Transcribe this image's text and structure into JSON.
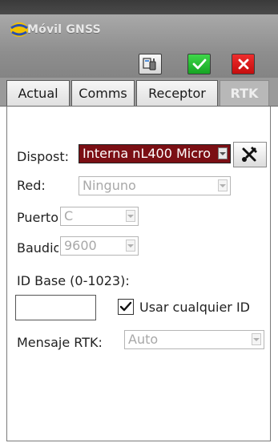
{
  "window": {
    "title": "Móvil GNSS",
    "buttons": {
      "settings_icon": "settings-icon",
      "ok_icon": "checkmark-icon",
      "cancel_icon": "close-icon"
    }
  },
  "tabs": [
    {
      "label": "Actual"
    },
    {
      "label": "Comms"
    },
    {
      "label": "Receptor"
    },
    {
      "label": "RTK",
      "selected": true
    }
  ],
  "form": {
    "dispositivo": {
      "label": "Dispost:",
      "value": "Interna nL400 Micro"
    },
    "red": {
      "label": "Red:",
      "value": "Ninguno"
    },
    "puerto": {
      "label": "Puerto",
      "value": "C"
    },
    "baudios": {
      "label": "Baudios",
      "value": "9600"
    },
    "id_base": {
      "label": "ID Base (0-1023):",
      "value": ""
    },
    "usar_cualquier_id": {
      "label": "Usar cualquier ID",
      "checked": true
    },
    "mensaje_rtk": {
      "label": "Mensaje RTK:",
      "value": "Auto"
    }
  },
  "colors": {
    "selected_combo_bg": "#7b0f14",
    "ok_green": "#2bc23a",
    "cancel_red": "#e01f1f",
    "disabled_text": "#a8a8a8"
  }
}
